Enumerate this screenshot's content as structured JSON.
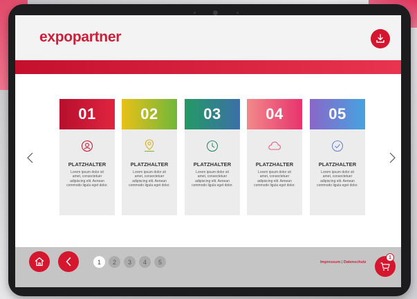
{
  "brand": {
    "name": "expopartner",
    "color": "#cc1f39"
  },
  "header": {
    "download_icon": "download-icon"
  },
  "carousel": {
    "prev_icon": "chevron-left-icon",
    "next_icon": "chevron-right-icon",
    "cards": [
      {
        "number": "01",
        "icon": "profile-icon",
        "title": "PLATZHALTER",
        "text": "Lorem ipsum dolor sit amet, consectetuer adipiscing elit. Aenean commodo ligula eget dolor.",
        "gradient": [
          "#b70f2e",
          "#e0243f"
        ]
      },
      {
        "number": "02",
        "icon": "location-pin-icon",
        "title": "PLATZHALTER",
        "text": "Lorem ipsum dolor sit amet, consectetuer adipiscing elit. Aenean commodo ligula eget dolor.",
        "gradient": [
          "#e8c118",
          "#71b73a"
        ]
      },
      {
        "number": "03",
        "icon": "clock-icon",
        "title": "PLATZHALTER",
        "text": "Lorem ipsum dolor sit amet, consectetuer adipiscing elit. Aenean commodo ligula eget dolor.",
        "gradient": [
          "#239a64",
          "#3c6fa8"
        ]
      },
      {
        "number": "04",
        "icon": "cloud-icon",
        "title": "PLATZHALTER",
        "text": "Lorem ipsum dolor sit amet, consectetuer adipiscing elit. Aenean commodo ligula eget dolor.",
        "gradient": [
          "#f2898a",
          "#e8336e"
        ]
      },
      {
        "number": "05",
        "icon": "check-circle-icon",
        "title": "PLATZHALTER",
        "text": "Lorem ipsum dolor sit amet, consectetuer adipiscing elit. Aenean commodo ligula eget dolor.",
        "gradient": [
          "#8a67c9",
          "#46a2e0"
        ]
      }
    ]
  },
  "footer": {
    "home_icon": "home-icon",
    "back_icon": "chevron-left-icon",
    "pages": [
      "1",
      "2",
      "3",
      "4",
      "5"
    ],
    "active_page": "1",
    "impressum": "Impressum",
    "separator": "|",
    "datenschutz": "Datenschutz",
    "cart_icon": "shopping-cart-icon",
    "cart_count": "1"
  }
}
